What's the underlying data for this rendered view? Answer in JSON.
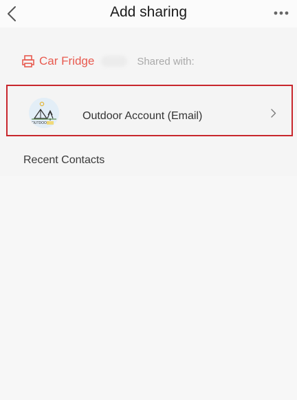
{
  "header": {
    "title": "Add sharing"
  },
  "device": {
    "name": "Car Fridge",
    "shared_with_label": "Shared with:"
  },
  "account_option": {
    "label": "Outdoor Account (Email)",
    "logo_text": "OUTDOOR"
  },
  "recent_contacts": {
    "title": "Recent Contacts",
    "items": []
  },
  "colors": {
    "accent": "#e85a4f",
    "highlight_border": "#c8262c",
    "background": "#f5f5f5"
  },
  "icons": {
    "back": "chevron-left-icon",
    "more": "more-dots-icon",
    "device": "printer-icon",
    "account_arrow": "chevron-right-icon"
  }
}
